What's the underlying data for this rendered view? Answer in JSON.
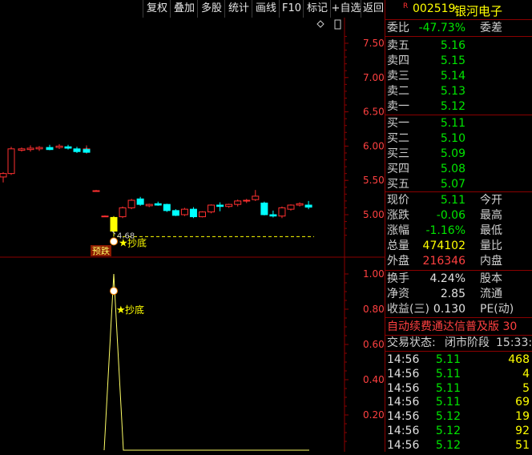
{
  "toolbar": {
    "buttons": [
      "复权",
      "叠加",
      "多股",
      "统计",
      "画线",
      "F10",
      "标记",
      "+自选",
      "返回"
    ]
  },
  "main_chart": {
    "y_ticks": [
      "7.50",
      "7.00",
      "6.50",
      "6.00",
      "5.50",
      "5.00"
    ],
    "y_values": [
      7.5,
      7.0,
      6.5,
      6.0,
      5.5,
      5.0
    ],
    "low_label": "4.68",
    "low_value": 4.68,
    "signal_label": "抄底",
    "warn_label": "预跌",
    "candles": [
      {
        "o": 5.55,
        "h": 5.62,
        "l": 5.47,
        "c": 5.6
      },
      {
        "o": 5.6,
        "h": 5.99,
        "l": 5.58,
        "c": 5.96
      },
      {
        "o": 5.94,
        "h": 5.98,
        "l": 5.92,
        "c": 5.96
      },
      {
        "o": 5.95,
        "h": 6.01,
        "l": 5.92,
        "c": 5.97
      },
      {
        "o": 5.96,
        "h": 6.0,
        "l": 5.93,
        "c": 5.98
      },
      {
        "o": 5.98,
        "h": 6.02,
        "l": 5.94,
        "c": 5.95
      },
      {
        "o": 5.98,
        "h": 6.03,
        "l": 5.96,
        "c": 6.0
      },
      {
        "o": 5.99,
        "h": 6.02,
        "l": 5.95,
        "c": 5.97
      },
      {
        "o": 5.96,
        "h": 5.99,
        "l": 5.9,
        "c": 5.92
      },
      {
        "o": 5.92,
        "h": 6.01,
        "l": 5.89,
        "c": 5.96
      },
      {
        "o": 5.95,
        "h": 5.98,
        "l": 5.9,
        "c": 5.91
      },
      {
        "o": 5.35,
        "h": 5.36,
        "l": 5.34,
        "c": 5.35
      },
      {
        "o": 4.98,
        "h": 4.99,
        "l": 4.97,
        "c": 4.98
      },
      {
        "o": 4.76,
        "h": 4.98,
        "l": 4.68,
        "c": 4.96
      },
      {
        "o": 4.97,
        "h": 5.12,
        "l": 4.95,
        "c": 5.1
      },
      {
        "o": 5.1,
        "h": 5.23,
        "l": 5.08,
        "c": 5.21
      },
      {
        "o": 5.23,
        "h": 5.26,
        "l": 5.13,
        "c": 5.15
      },
      {
        "o": 5.13,
        "h": 5.16,
        "l": 5.11,
        "c": 5.15
      },
      {
        "o": 5.16,
        "h": 5.19,
        "l": 5.13,
        "c": 5.14
      },
      {
        "o": 5.15,
        "h": 5.16,
        "l": 5.04,
        "c": 5.06
      },
      {
        "o": 5.06,
        "h": 5.08,
        "l": 4.98,
        "c": 4.99
      },
      {
        "o": 5.0,
        "h": 5.1,
        "l": 4.98,
        "c": 5.08
      },
      {
        "o": 5.08,
        "h": 5.11,
        "l": 4.95,
        "c": 4.97
      },
      {
        "o": 4.97,
        "h": 5.05,
        "l": 4.96,
        "c": 5.04
      },
      {
        "o": 5.04,
        "h": 5.15,
        "l": 5.02,
        "c": 5.14
      },
      {
        "o": 5.14,
        "h": 5.18,
        "l": 5.05,
        "c": 5.12
      },
      {
        "o": 5.12,
        "h": 5.16,
        "l": 5.1,
        "c": 5.15
      },
      {
        "o": 5.15,
        "h": 5.22,
        "l": 5.12,
        "c": 5.2
      },
      {
        "o": 5.2,
        "h": 5.23,
        "l": 5.17,
        "c": 5.21
      },
      {
        "o": 5.22,
        "h": 5.36,
        "l": 5.2,
        "c": 5.27
      },
      {
        "o": 5.17,
        "h": 5.19,
        "l": 4.99,
        "c": 5.0
      },
      {
        "o": 5.0,
        "h": 5.06,
        "l": 4.96,
        "c": 4.98
      },
      {
        "o": 4.98,
        "h": 5.12,
        "l": 4.95,
        "c": 5.1
      },
      {
        "o": 5.08,
        "h": 5.15,
        "l": 5.06,
        "c": 5.14
      },
      {
        "o": 5.14,
        "h": 5.18,
        "l": 5.12,
        "c": 5.16
      },
      {
        "o": 5.14,
        "h": 5.2,
        "l": 5.08,
        "c": 5.11
      }
    ]
  },
  "indicator": {
    "y_ticks": [
      "1.00",
      "0.80",
      "0.60",
      "0.40",
      "0.20"
    ],
    "y_values": [
      1.0,
      0.8,
      0.6,
      0.4,
      0.2
    ],
    "signal_label": "抄底",
    "series": [
      0,
      0,
      0,
      0,
      0,
      0,
      0,
      0,
      0,
      0,
      0,
      0,
      0,
      0,
      0,
      0,
      0,
      0,
      0,
      1,
      0,
      0,
      0,
      0,
      0,
      0,
      0,
      0,
      0,
      0,
      0,
      0,
      0,
      0,
      0,
      0,
      0,
      0,
      0,
      0,
      0,
      0,
      0,
      0,
      0
    ]
  },
  "quote": {
    "badge": "R",
    "code": "002519",
    "name": "银河电子",
    "webi_label": "委比",
    "webi_value": "-47.73%",
    "weicha_label": "委差",
    "asks": [
      {
        "label": "卖五",
        "price": "5.16"
      },
      {
        "label": "卖四",
        "price": "5.15"
      },
      {
        "label": "卖三",
        "price": "5.14"
      },
      {
        "label": "卖二",
        "price": "5.13"
      },
      {
        "label": "卖一",
        "price": "5.12"
      }
    ],
    "bids": [
      {
        "label": "买一",
        "price": "5.11"
      },
      {
        "label": "买二",
        "price": "5.10"
      },
      {
        "label": "买三",
        "price": "5.09"
      },
      {
        "label": "买四",
        "price": "5.08"
      },
      {
        "label": "买五",
        "price": "5.07"
      }
    ],
    "stats": [
      {
        "label": "现价",
        "value": "5.11",
        "label2": "今开",
        "color": "green"
      },
      {
        "label": "涨跌",
        "value": "-0.06",
        "label2": "最高",
        "color": "green"
      },
      {
        "label": "涨幅",
        "value": "-1.16%",
        "label2": "最低",
        "color": "green"
      },
      {
        "label": "总量",
        "value": "474102",
        "label2": "量比",
        "color": "yellow"
      },
      {
        "label": "外盘",
        "value": "216346",
        "label2": "内盘",
        "color": "red"
      }
    ],
    "fundamentals": [
      {
        "label": "换手",
        "value": "4.24%",
        "label2": "股本"
      },
      {
        "label": "净资",
        "value": "2.85",
        "label2": "流通"
      },
      {
        "label": "收益(三)",
        "value": "0.130",
        "label2": "PE(动)"
      }
    ],
    "ticker": "自动续费通达信普及版 30",
    "status_label": "交易状态:",
    "status_value": "闭市阶段",
    "status_time": "15:33:",
    "ticks": [
      {
        "time": "14:56",
        "price": "5.11",
        "vol": "468",
        "color": "yellow"
      },
      {
        "time": "14:56",
        "price": "5.11",
        "vol": "4",
        "color": "yellow"
      },
      {
        "time": "14:56",
        "price": "5.11",
        "vol": "5",
        "color": "yellow"
      },
      {
        "time": "14:56",
        "price": "5.11",
        "vol": "69",
        "color": "yellow"
      },
      {
        "time": "14:56",
        "price": "5.12",
        "vol": "19",
        "color": "yellow"
      },
      {
        "time": "14:56",
        "price": "5.12",
        "vol": "92",
        "color": "yellow"
      },
      {
        "time": "14:56",
        "price": "5.12",
        "vol": "51",
        "color": "yellow"
      }
    ]
  },
  "colors": {
    "up": "#ff3030",
    "down": "#00ffff",
    "grid": "#8b0000",
    "axis_text": "#ff4040",
    "indicator": "#ffff66"
  }
}
